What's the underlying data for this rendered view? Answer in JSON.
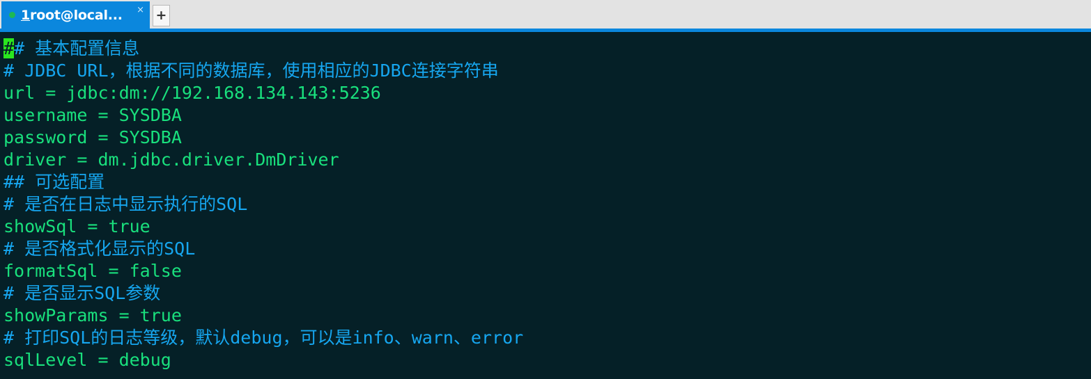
{
  "window": {
    "tab": {
      "index": "1",
      "title": "root@local...",
      "close_label": "×",
      "status_dot_color": "#1db954",
      "active_color": "#0b87dd"
    },
    "new_tab_label": "+",
    "titlebar_bg": "#e3e3e3"
  },
  "terminal": {
    "background": "#052027",
    "comment_color": "#16a6ef",
    "value_color": "#19e07d",
    "cursor_color": "#2ae61f",
    "cursor_char": "#",
    "lines": [
      {
        "segments": [
          {
            "text": "#",
            "style": "cursor"
          },
          {
            "text": "# 基本配置信息",
            "style": "comment"
          }
        ]
      },
      {
        "segments": [
          {
            "text": "# JDBC URL，根据不同的数据库，使用相应的JDBC连接字符串",
            "style": "comment"
          }
        ]
      },
      {
        "segments": [
          {
            "text": "url = jdbc:dm://192.168.134.143:5236",
            "style": "value"
          }
        ]
      },
      {
        "segments": [
          {
            "text": "username = SYSDBA",
            "style": "value"
          }
        ]
      },
      {
        "segments": [
          {
            "text": "password = SYSDBA",
            "style": "value"
          }
        ]
      },
      {
        "segments": [
          {
            "text": "driver = dm.jdbc.driver.DmDriver",
            "style": "value"
          }
        ]
      },
      {
        "segments": [
          {
            "text": "## 可选配置",
            "style": "comment"
          }
        ]
      },
      {
        "segments": [
          {
            "text": "# 是否在日志中显示执行的SQL",
            "style": "comment"
          }
        ]
      },
      {
        "segments": [
          {
            "text": "showSql = true",
            "style": "value"
          }
        ]
      },
      {
        "segments": [
          {
            "text": "# 是否格式化显示的SQL",
            "style": "comment"
          }
        ]
      },
      {
        "segments": [
          {
            "text": "formatSql = false",
            "style": "value"
          }
        ]
      },
      {
        "segments": [
          {
            "text": "# 是否显示SQL参数",
            "style": "comment"
          }
        ]
      },
      {
        "segments": [
          {
            "text": "showParams = true",
            "style": "value"
          }
        ]
      },
      {
        "segments": [
          {
            "text": "# 打印SQL的日志等级，默认debug，可以是info、warn、error",
            "style": "comment"
          }
        ]
      },
      {
        "segments": [
          {
            "text": "sqlLevel = debug",
            "style": "value"
          }
        ]
      }
    ]
  }
}
